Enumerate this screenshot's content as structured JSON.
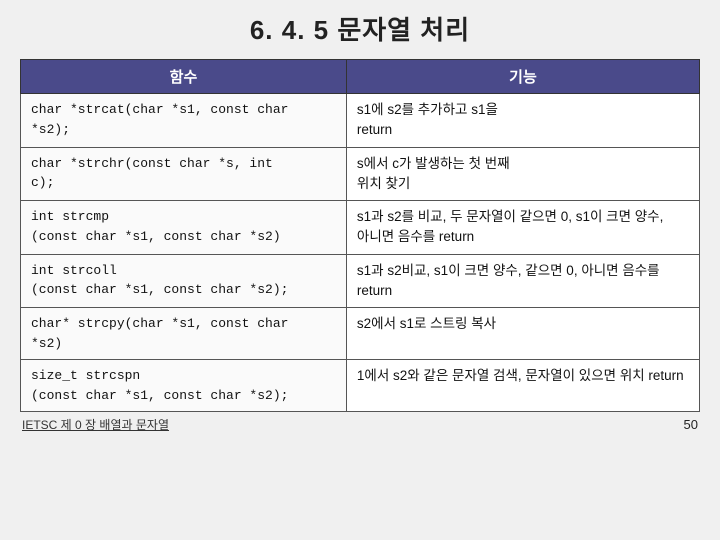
{
  "title": "6. 4. 5  문자열  처리",
  "table": {
    "headers": [
      "함수",
      "기능"
    ],
    "rows": [
      {
        "func": "char *strcat(char *s1, const char *s2);",
        "desc": "s1에 s2를 추가하고 s1을 return"
      },
      {
        "func": "char *strchr(const char *s, int c);",
        "desc": "s에서 c가 발생하는 첫 번째 위치 찾기"
      },
      {
        "func": "int strcmp\n(const char *s1, const char *s2)",
        "desc": "s1과 s2를 비교, 두 문자열이 같으면 0, s1이 크면 양수, 아니면 음수를 return"
      },
      {
        "func": "int strcoll\n(const char *s1, const char *s2);",
        "desc": "s1과 s2비교, s1이 크면 양수, 같으면 0, 아니면 음수를 return"
      },
      {
        "func": "char* strcpy(char *s1, const char *s2)",
        "desc": "s2에서 s1로 스트링 복사"
      },
      {
        "func": "size_t strcspn\n(const char *s1, const char *s2);",
        "desc": "1에서 s2와 같은 문자열 검색, 문자열이 있으면 위치 return"
      }
    ]
  },
  "footer": {
    "link_text": "IETSC 제 0 장 배열과 문자열",
    "page_number": "50"
  }
}
